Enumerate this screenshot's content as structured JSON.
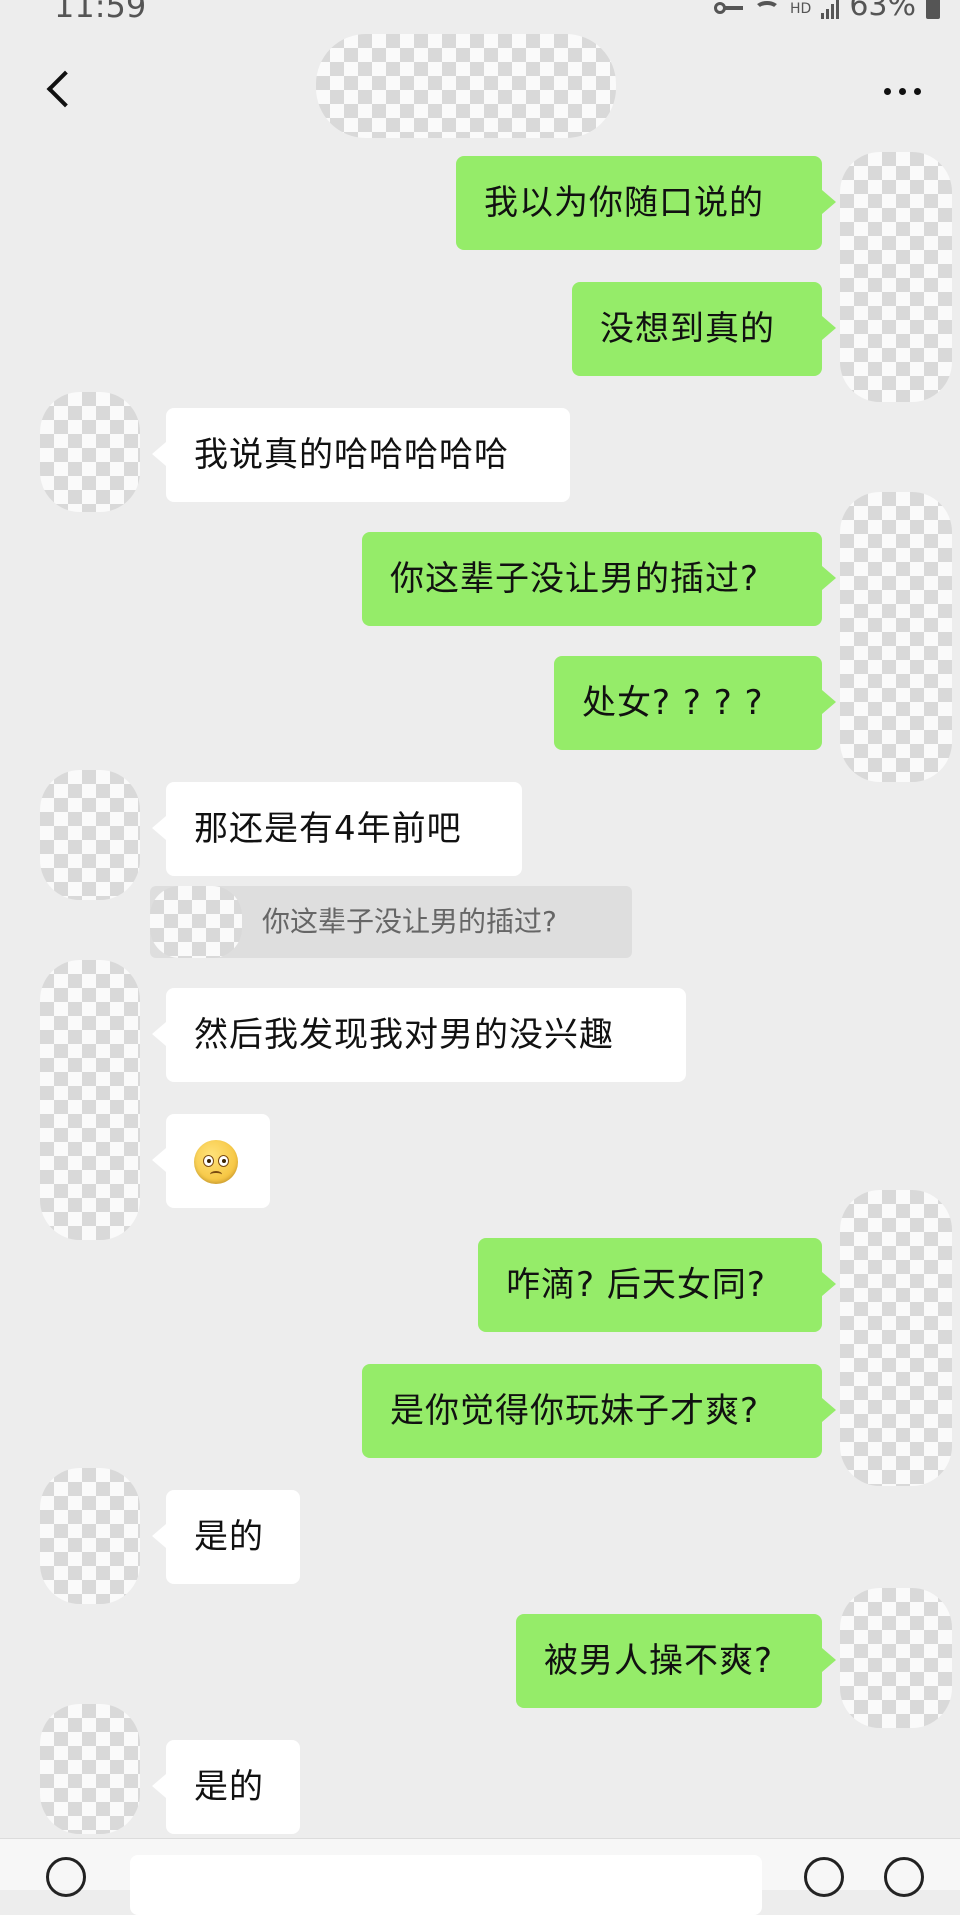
{
  "status_bar": {
    "time": "11:59",
    "network": "HD",
    "battery": "63%"
  },
  "header": {
    "more_label": "···"
  },
  "messages": [
    {
      "side": "right",
      "text": "我以为你随口说的"
    },
    {
      "side": "right",
      "text": "没想到真的"
    },
    {
      "side": "left",
      "text": "我说真的哈哈哈哈哈"
    },
    {
      "side": "right",
      "text": "你这辈子没让男的插过?"
    },
    {
      "side": "right",
      "text": "处女? ? ? ?"
    },
    {
      "side": "left",
      "text": "那还是有4年前吧"
    },
    {
      "side": "left",
      "text": "然后我发现我对男的没兴趣"
    },
    {
      "side": "left",
      "emoji": "pleading-face"
    },
    {
      "side": "right",
      "text": "咋滴? 后天女同?"
    },
    {
      "side": "right",
      "text": "是你觉得你玩妹子才爽?"
    },
    {
      "side": "left",
      "text": "是的"
    },
    {
      "side": "right",
      "text": "被男人操不爽?"
    },
    {
      "side": "left",
      "text": "是的"
    }
  ],
  "quote": {
    "text": "你这辈子没让男的插过?"
  },
  "colors": {
    "background": "#ededed",
    "self_bubble": "#95ec69",
    "other_bubble": "#ffffff",
    "quote_bg": "#dedede"
  },
  "input_bar": {
    "placeholder": ""
  }
}
